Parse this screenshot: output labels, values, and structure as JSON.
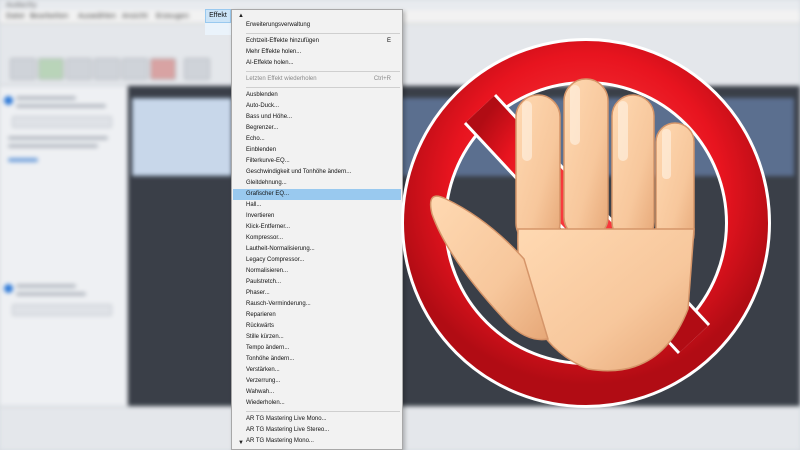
{
  "app": {
    "title": "Audacity"
  },
  "menubar": {
    "items": [
      "Datei",
      "Bearbeiten",
      "Auswählen",
      "Ansicht",
      "Erzeugen",
      "Effekt"
    ],
    "active": "Effekt"
  },
  "effect_menu": {
    "title": "Effekt",
    "items": [
      {
        "label": "Erweiterungsverwaltung"
      },
      {
        "label": "Echtzeit-Effekte hinzufügen",
        "shortcut": "E"
      },
      {
        "label": "Mehr Effekte holen..."
      },
      {
        "label": "AI-Effekte holen..."
      },
      {
        "label": "Letzten Effekt wiederholen",
        "shortcut": "Ctrl+R",
        "disabled": true
      },
      {
        "label": "Ausblenden"
      },
      {
        "label": "Auto-Duck..."
      },
      {
        "label": "Bass und Höhe..."
      },
      {
        "label": "Begrenzer..."
      },
      {
        "label": "Echo..."
      },
      {
        "label": "Einblenden"
      },
      {
        "label": "Filterkurve-EQ..."
      },
      {
        "label": "Geschwindigkeit und Tonhöhe ändern..."
      },
      {
        "label": "Gleitdehnung..."
      },
      {
        "label": "Grafischer EQ...",
        "highlighted": true
      },
      {
        "label": "Hall..."
      },
      {
        "label": "Invertieren"
      },
      {
        "label": "Klick-Entferner..."
      },
      {
        "label": "Kompressor..."
      },
      {
        "label": "Lautheit-Normalisierung..."
      },
      {
        "label": "Legacy Compressor..."
      },
      {
        "label": "Normalisieren..."
      },
      {
        "label": "Paulstretch..."
      },
      {
        "label": "Phaser..."
      },
      {
        "label": "Rausch-Verminderung..."
      },
      {
        "label": "Reparieren"
      },
      {
        "label": "Rückwärts"
      },
      {
        "label": "Stille kürzen..."
      },
      {
        "label": "Tempo ändern..."
      },
      {
        "label": "Tonhöhe ändern..."
      },
      {
        "label": "Verstärken..."
      },
      {
        "label": "Verzerrung..."
      },
      {
        "label": "Wahwah..."
      },
      {
        "label": "Wiederholen..."
      },
      {
        "label": "AR TG Mastering Live Mono..."
      },
      {
        "label": "AR TG Mastering Live Stereo..."
      },
      {
        "label": "AR TG Mastering Mono..."
      }
    ]
  },
  "icons": {
    "scroll_up": "▲",
    "scroll_down": "▼",
    "overlay": "stop-hand-icon"
  },
  "colors": {
    "highlight": "#99c9ef",
    "menu_bg": "#f2f2f2",
    "stop_red": "#e8141f",
    "hand_skin": "#f7c79c"
  }
}
